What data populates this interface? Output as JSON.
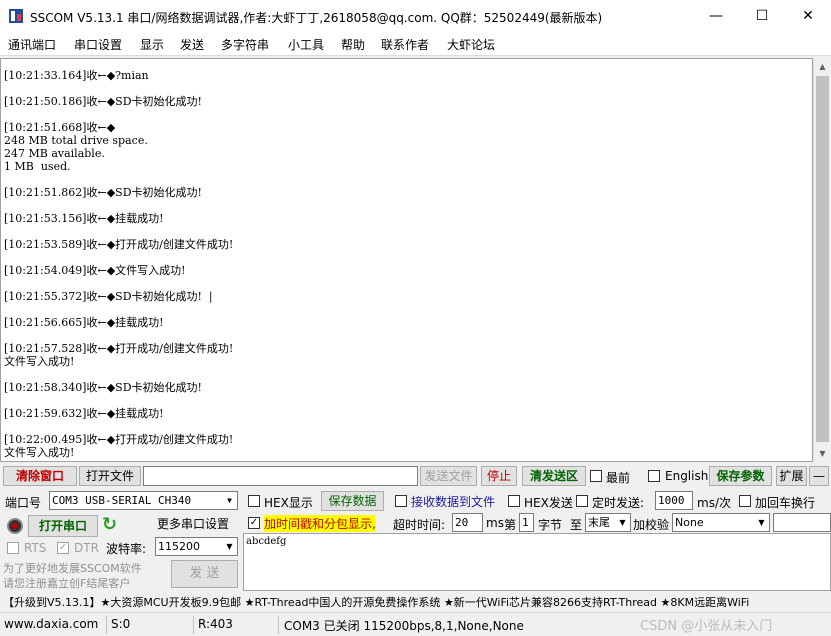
{
  "window": {
    "title": "SSCOM V5.13.1 串口/网络数据调试器,作者:大虾丁丁,2618058@qq.com. QQ群：52502449(最新版本)",
    "minimize": "—",
    "maximize": "☐",
    "close": "✕"
  },
  "menu": [
    "通讯端口",
    "串口设置",
    "显示",
    "发送",
    "多字符串",
    "小工具",
    "帮助",
    "联系作者",
    "大虾论坛"
  ],
  "receive_log": "[10:21:33.164]收←◆?mian\n\n[10:21:50.186]收←◆SD卡初始化成功!\n\n[10:21:51.668]收←◆\n248 MB total drive space.\n247 MB available.\n1 MB  used.\n\n[10:21:51.862]收←◆SD卡初始化成功!\n\n[10:21:53.156]收←◆挂载成功!\n\n[10:21:53.589]收←◆打开成功/创建文件成功!\n\n[10:21:54.049]收←◆文件写入成功!\n\n[10:21:55.372]收←◆SD卡初始化成功!  |\n\n[10:21:56.665]收←◆挂载成功!\n\n[10:21:57.528]收←◆打开成功/创建文件成功!\n文件写入成功!\n\n[10:21:58.340]收←◆SD卡初始化成功!\n\n[10:21:59.632]收←◆挂载成功!\n\n[10:22:00.495]收←◆打开成功/创建文件成功!\n文件写入成功!",
  "toolbar": {
    "clear_window": "清除窗口",
    "open_file": "打开文件",
    "send_file": "发送文件",
    "stop": "停止",
    "clear_send": "清发送区",
    "topmost": "最前",
    "english": "English",
    "save_params": "保存参数",
    "expand": "扩展",
    "collapse": "—"
  },
  "port": {
    "label": "端口号",
    "value": "COM3 USB-SERIAL CH340",
    "open_button": "打开串口",
    "more_settings": "更多串口设置",
    "rts": "RTS",
    "dtr": "DTR",
    "baud_label": "波特率:",
    "baud_value": "115200"
  },
  "options": {
    "hex_display": "HEX显示",
    "save_data": "保存数据",
    "recv_to_file": "接收数据到文件",
    "hex_send": "HEX发送",
    "timed_send": "定时发送:",
    "timed_ms": "1000",
    "ms_per": "ms/次",
    "add_crlf": "加回车换行",
    "timestamp": "加时间戳和分包显示,",
    "timeout_label": "超时时间:",
    "timeout_value": "20",
    "ms": "ms",
    "nth_label": "第",
    "nth_value": "1",
    "byte_label": "字节",
    "to_label": "至",
    "tail": "末尾",
    "checksum_label": "加校验",
    "checksum_value": "None"
  },
  "promo": {
    "line1": "为了更好地发展SSCOM软件",
    "line2": "请您注册嘉立创F结尾客户"
  },
  "send_button": "发  送",
  "send_text": "abcdefg",
  "ticker": "【升级到V5.13.1】★大资源MCU开发板9.9包邮 ★RT-Thread中国人的开源免费操作系统 ★新一代WiFi芯片兼容8266支持RT-Thread ★8KM远距离WiFi",
  "status": {
    "site": "www.daxia.com",
    "sent": "S:0",
    "received": "R:403",
    "port_state": "COM3 已关闭  115200bps,8,1,None,None"
  },
  "watermark": "CSDN @小张从未入门",
  "colors": {
    "red_text": "#c00000",
    "green_text": "#006400",
    "highlight": "#ffff00",
    "title_icon": "#1f4e9c"
  }
}
